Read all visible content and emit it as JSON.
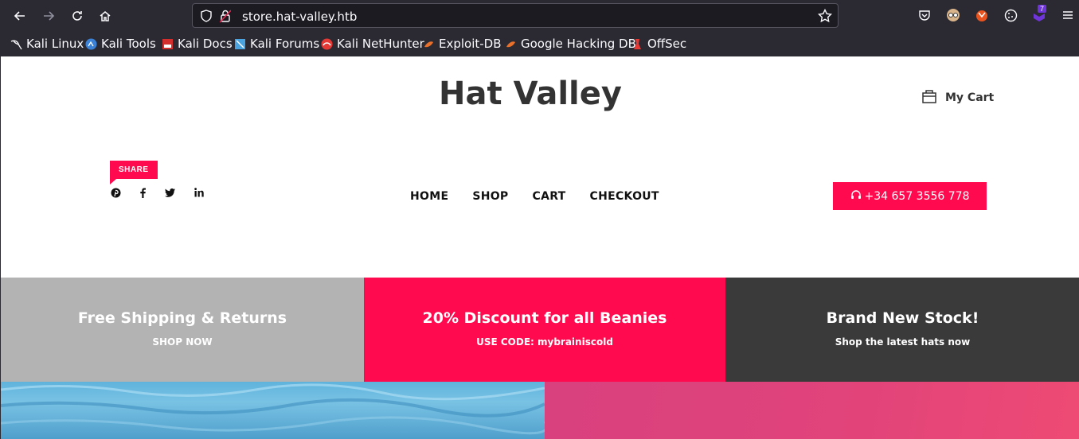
{
  "browser": {
    "url": "store.hat-valley.htb",
    "extension_badge": "7",
    "bookmarks": [
      {
        "label": "Kali Linux",
        "icon": "kali-dragon-icon"
      },
      {
        "label": "Kali Tools",
        "icon": "kali-tools-icon"
      },
      {
        "label": "Kali Docs",
        "icon": "kali-docs-icon"
      },
      {
        "label": "Kali Forums",
        "icon": "kali-forums-icon"
      },
      {
        "label": "Kali NetHunter",
        "icon": "kali-nethunter-icon"
      },
      {
        "label": "Exploit-DB",
        "icon": "exploit-db-icon"
      },
      {
        "label": "Google Hacking DB",
        "icon": "ghdb-icon"
      },
      {
        "label": "OffSec",
        "icon": "offsec-icon"
      }
    ]
  },
  "header": {
    "title": "Hat Valley",
    "cart_label": "My Cart"
  },
  "share": {
    "label": "SHARE",
    "networks": [
      "pinterest-icon",
      "facebook-icon",
      "twitter-icon",
      "linkedin-icon"
    ]
  },
  "nav": {
    "items": [
      "HOME",
      "SHOP",
      "CART",
      "CHECKOUT"
    ]
  },
  "phone": "+34 657 3556 778",
  "promos": [
    {
      "title": "Free Shipping & Returns",
      "subtitle": "SHOP NOW",
      "color": "#b3b3b3"
    },
    {
      "title": "20% Discount for all Beanies",
      "subtitle": "USE CODE: mybrainiscold",
      "color": "#ff0a4e"
    },
    {
      "title": "Brand New Stock!",
      "subtitle": "Shop the latest hats now",
      "color": "#3a3a3a"
    }
  ],
  "colors": {
    "accent": "#ff0a4e",
    "chrome_bg": "#2b2a33",
    "title_text": "#333333"
  }
}
